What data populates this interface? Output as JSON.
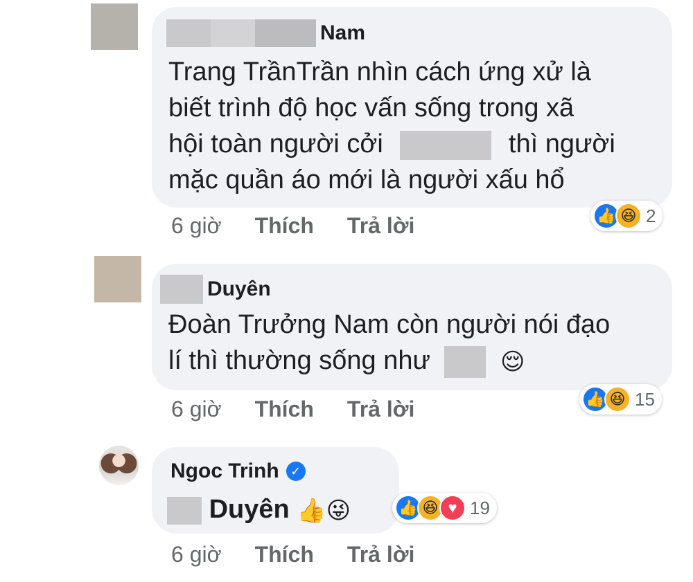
{
  "comments": [
    {
      "author_suffix": "Nam",
      "lines": [
        "Trang TrầnTrần nhìn cách ứng xử là",
        "biết trình độ học vấn sống trong xã",
        "hội toàn người cởi",
        "thì người",
        "mặc quần áo mới là người xấu hổ"
      ],
      "time": "6 giờ",
      "like_label": "Thích",
      "reply_label": "Trả lời",
      "reaction_count": "2",
      "reactions": [
        "like-icon",
        "haha-icon"
      ]
    },
    {
      "author_suffix": "Duyên",
      "lines": [
        "Đoàn Trưởng Nam còn người nói đạo",
        "lí thì thường sống như"
      ],
      "emoji": "😌",
      "time": "6 giờ",
      "like_label": "Thích",
      "reply_label": "Trả lời",
      "reaction_count": "15",
      "reactions": [
        "like-icon",
        "haha-icon"
      ]
    },
    {
      "author": "Ngoc Trinh",
      "verified": true,
      "mention_suffix": "Duyên",
      "emojis": "👍😜",
      "time": "6 giờ",
      "like_label": "Thích",
      "reply_label": "Trả lời",
      "reaction_count": "19",
      "reactions": [
        "like-icon",
        "haha-icon",
        "love-icon"
      ]
    }
  ],
  "colors": {
    "bubble": "#f0f2f5",
    "action_text": "#65676b",
    "like": "#1877f2",
    "love": "#f33e58",
    "haha": "#f7b125"
  }
}
